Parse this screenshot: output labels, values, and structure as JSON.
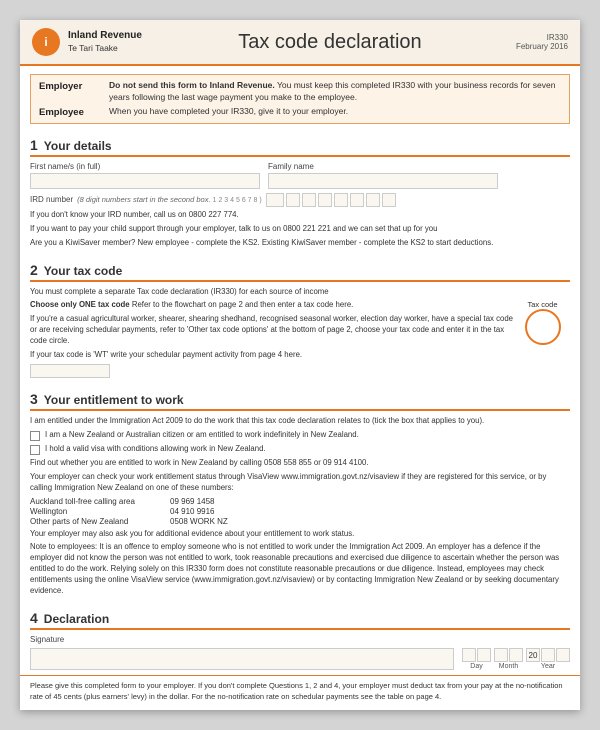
{
  "header": {
    "logo_line1": "Inland Revenue",
    "logo_line2": "Te Tari Taake",
    "logo_initial": "i",
    "title": "Tax code declaration",
    "ref_code": "IR330",
    "ref_date": "February 2016"
  },
  "notice": {
    "employer_label": "Employer",
    "employer_text_bold": "Do not send this form to Inland Revenue.",
    "employer_text": " You must keep this completed IR330 with your business records for seven years following the last wage payment you make to the employee.",
    "employee_label": "Employee",
    "employee_text": "When you have completed your IR330, give it to your employer."
  },
  "section1": {
    "number": "1",
    "title": "Your details",
    "first_name_label": "First name/s (in full)",
    "family_name_label": "Family name",
    "ird_label": "IRD number",
    "ird_hint": "(8 digit numbers start in the second box.",
    "ird_example": "1  2  3  4  5  6  7  8  )",
    "ird_note": "If you don't know your IRD number, call us on 0800 227 774.",
    "child_support_text": "If you want to pay your child support through your employer, talk to us on 0800 221 221 and we can set that up for you",
    "kiwisaver_text": "Are you a KiwiSaver member? New employee - complete the KS2. Existing KiwiSaver member - complete the KS2 to start deductions."
  },
  "section2": {
    "number": "2",
    "title": "Your tax code",
    "intro": "You must complete a separate Tax code declaration (IR330) for each source of income",
    "choose_label": "Choose only ONE tax code",
    "refer_text": "Refer to the flowchart on page 2 and then enter a tax code here.",
    "tax_code_label": "Tax code",
    "casual_text": "If you're a casual agricultural worker, shearer, shearing shedhand, recognised seasonal worker, election day worker, have a special tax code or are receiving schedular payments, refer to 'Other tax code options' at the bottom of page 2, choose your tax code and enter it in the tax code circle.",
    "wt_text": "If your tax code is 'WT' write your schedular payment activity from page 4 here."
  },
  "section3": {
    "number": "3",
    "title": "Your entitlement to work",
    "intro": "I am entitled under the Immigration Act 2009 to do the work that this tax code declaration relates to (tick the box that applies to you).",
    "checkbox1": "I am a New Zealand or Australian citizen or am entitled to work indefinitely in New Zealand.",
    "checkbox2": "I hold a valid visa with conditions allowing work in New Zealand.",
    "find_text": "Find out whether you are entitled to work in New Zealand by calling 0508 558 855 or 09 914 4100.",
    "visaview_text": "Your employer can check your work entitlement status through VisaView www.immigration.govt.nz/visaview if they are registered for this service, or by calling Immigration New Zealand on one of these numbers:",
    "auckland_label": "Auckland toll-free calling area",
    "auckland_number": "09 969 1458",
    "wellington_label": "Wellington",
    "wellington_number": "04 910 9916",
    "other_label": "Other parts of New Zealand",
    "other_number": "0508 WORK NZ",
    "employer_ask_text": "Your employer may also ask you for additional evidence about your entitlement to work status.",
    "note_text": "Note to employees: It is an offence to employ someone who is not entitled to work under the Immigration Act 2009. An employer has a defence if the employer did not know the person was not entitled to work, took reasonable precautions and exercised due diligence to ascertain whether the person was entitled to do the work. Relying solely on this IR330 form does not constitute reasonable precautions or due diligence. Instead, employees may check entitlements using the online VisaView service (www.immigration.govt.nz/visaview) or by contacting Immigration New Zealand or by seeking documentary evidence."
  },
  "section4": {
    "number": "4",
    "title": "Declaration",
    "sig_label": "Signature",
    "day_label": "Day",
    "month_label": "Month",
    "year_label": "Year",
    "year_prefill": "20"
  },
  "footer": {
    "text": "Please give this completed form to your employer. If you don't complete Questions 1, 2 and 4, your employer must deduct tax from your pay at the no-notification rate of 45 cents (plus earners' levy) in the dollar. For the no-notification rate on schedular payments see the table on page 4."
  }
}
